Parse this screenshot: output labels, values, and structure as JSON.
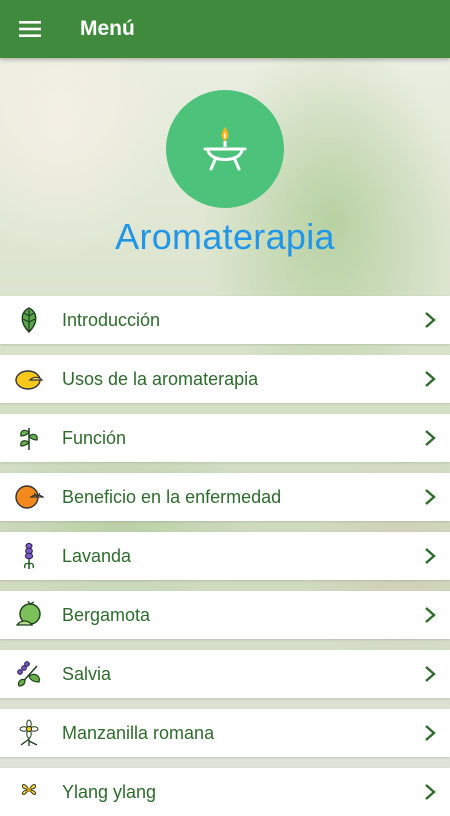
{
  "appbar": {
    "title": "Menú",
    "menu_icon": "hamburger-menu-icon"
  },
  "header": {
    "logo_icon": "aroma-diffuser-candle-icon",
    "brand": "Aromaterapia"
  },
  "menu": {
    "items": [
      {
        "label": "Introducción",
        "icon": "mint-leaf-icon"
      },
      {
        "label": "Usos de la aromaterapia",
        "icon": "lemon-icon"
      },
      {
        "label": "Función",
        "icon": "herb-sprig-icon"
      },
      {
        "label": "Beneficio en la enfermedad",
        "icon": "orange-slice-icon"
      },
      {
        "label": "Lavanda",
        "icon": "lavender-icon"
      },
      {
        "label": "Bergamota",
        "icon": "bergamot-icon"
      },
      {
        "label": "Salvia",
        "icon": "sage-icon"
      },
      {
        "label": "Manzanilla romana",
        "icon": "chamomile-icon"
      },
      {
        "label": "Ylang ylang",
        "icon": "ylang-flower-icon"
      }
    ]
  },
  "colors": {
    "appbar": "#3f8a3c",
    "item_text": "#2e6b2d",
    "brand": "#2196e6",
    "logo_circle": "#4cc27b"
  }
}
